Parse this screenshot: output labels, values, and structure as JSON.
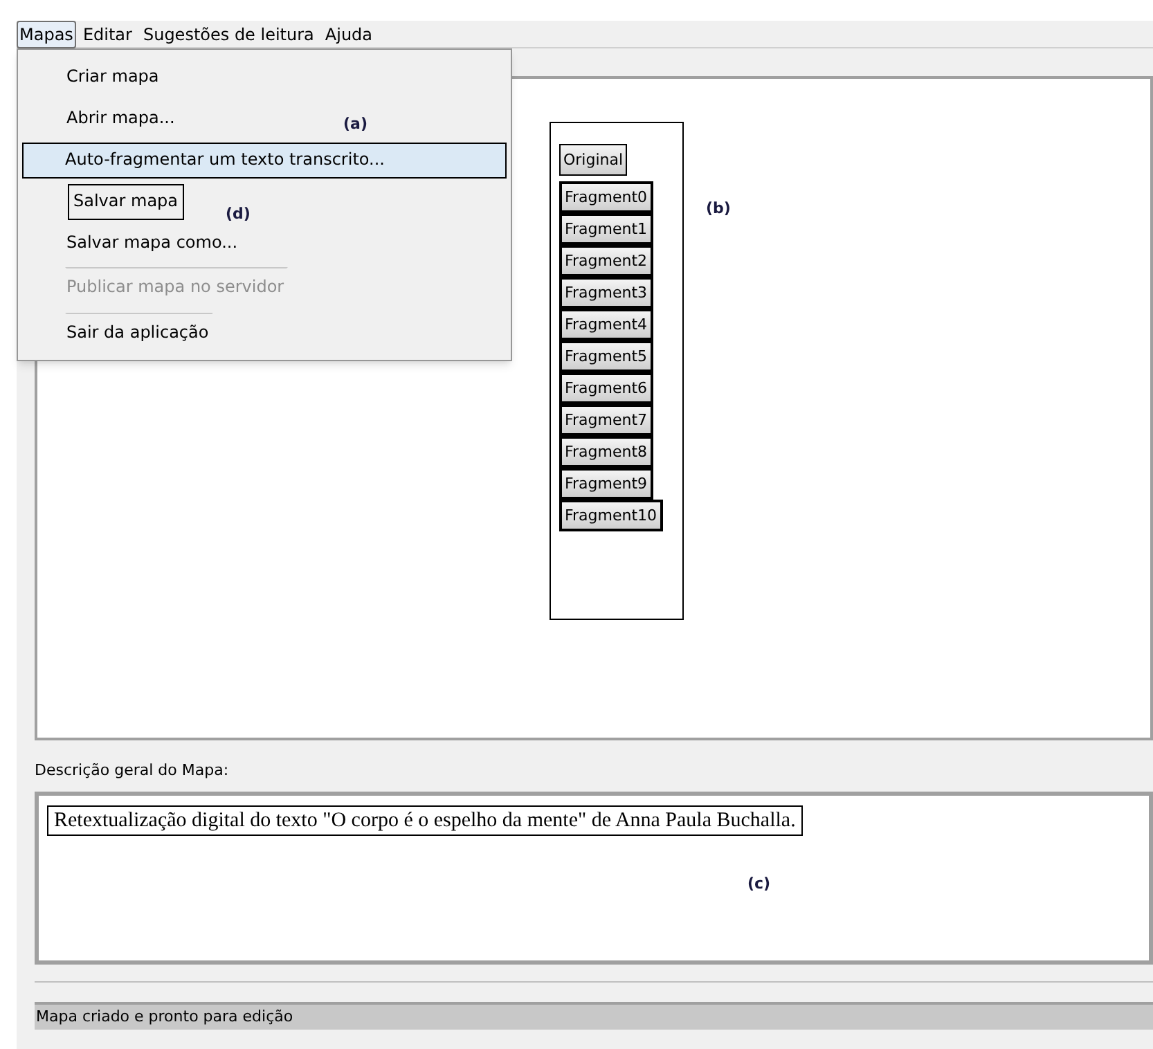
{
  "menubar": [
    {
      "label": "Mapas",
      "selected": true
    },
    {
      "label": "Editar",
      "selected": false
    },
    {
      "label": "Sugestões de leitura",
      "selected": false
    },
    {
      "label": "Ajuda",
      "selected": false
    }
  ],
  "menu": [
    {
      "label": "Criar mapa",
      "selected": false,
      "disabled": false,
      "outlined": false,
      "separator_before": false
    },
    {
      "label": "Abrir mapa...",
      "selected": false,
      "disabled": false,
      "outlined": false,
      "separator_before": false
    },
    {
      "label": "Auto-fragmentar um texto transcrito...",
      "selected": true,
      "disabled": false,
      "outlined": false,
      "separator_before": false
    },
    {
      "label": "Salvar mapa",
      "selected": false,
      "disabled": false,
      "outlined": true,
      "separator_before": false
    },
    {
      "label": "Salvar mapa como...",
      "selected": false,
      "disabled": false,
      "outlined": false,
      "separator_before": false
    },
    {
      "label": "Publicar mapa no servidor",
      "selected": false,
      "disabled": true,
      "outlined": false,
      "separator_before": true
    },
    {
      "label": "Sair da aplicação",
      "selected": false,
      "disabled": false,
      "outlined": false,
      "separator_before": true
    }
  ],
  "fragments": [
    "Original",
    "Fragment0",
    "Fragment1",
    "Fragment2",
    "Fragment3",
    "Fragment4",
    "Fragment5",
    "Fragment6",
    "Fragment7",
    "Fragment8",
    "Fragment9",
    "Fragment10"
  ],
  "description": {
    "label": "Descrição geral do Mapa:",
    "text": "Retextualização digital do texto \"O corpo é o espelho da mente\" de Anna Paula Buchalla."
  },
  "annotations": [
    "(a)",
    "(b)",
    "(c)",
    "(d)"
  ],
  "status_bar": "Mapa criado e pronto para edição"
}
